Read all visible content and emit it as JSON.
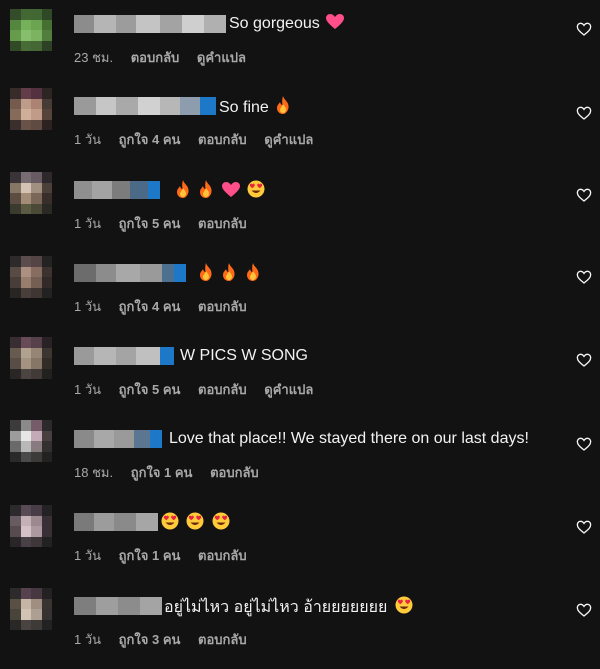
{
  "comments": [
    {
      "text": "So gorgeous",
      "emojis": [
        "pink-heart"
      ],
      "time": "23 ชม.",
      "likes": "",
      "reply": "ตอบกลับ",
      "translate": "ดูคำแปล"
    },
    {
      "text": "So fine",
      "emojis": [
        "fire"
      ],
      "time": "1 วัน",
      "likes": "ถูกใจ 4 คน",
      "reply": "ตอบกลับ",
      "translate": "ดูคำแปล"
    },
    {
      "text": "",
      "emojis": [
        "fire",
        "fire",
        "pink-heart",
        "heart-eyes"
      ],
      "time": "1 วัน",
      "likes": "ถูกใจ 5 คน",
      "reply": "ตอบกลับ",
      "translate": ""
    },
    {
      "text": "",
      "emojis": [
        "fire",
        "fire",
        "fire"
      ],
      "time": "1 วัน",
      "likes": "ถูกใจ 4 คน",
      "reply": "ตอบกลับ",
      "translate": ""
    },
    {
      "text": "W PICS W SONG",
      "emojis": [],
      "time": "1 วัน",
      "likes": "ถูกใจ 5 คน",
      "reply": "ตอบกลับ",
      "translate": "ดูคำแปล"
    },
    {
      "text": "Love that place!! We stayed there on our last days!",
      "emojis": [],
      "time": "18 ชม.",
      "likes": "ถูกใจ 1 คน",
      "reply": "ตอบกลับ",
      "translate": ""
    },
    {
      "text": "",
      "emojis": [
        "heart-eyes",
        "heart-eyes",
        "heart-eyes"
      ],
      "time": "1 วัน",
      "likes": "ถูกใจ 1 คน",
      "reply": "ตอบกลับ",
      "translate": ""
    },
    {
      "text": "อยู่ไม่ไหว อยู่ไม่ไหว อ้ายยยยยยย",
      "emojis": [
        "heart-eyes"
      ],
      "time": "1 วัน",
      "likes": "ถูกใจ 3 คน",
      "reply": "ตอบกลับ",
      "translate": ""
    }
  ],
  "icons": {
    "like": "heart-outline-icon"
  },
  "colors": {
    "background": "#121212",
    "meta_text": "#a8a8a8",
    "body_text": "#f2f2f2"
  }
}
